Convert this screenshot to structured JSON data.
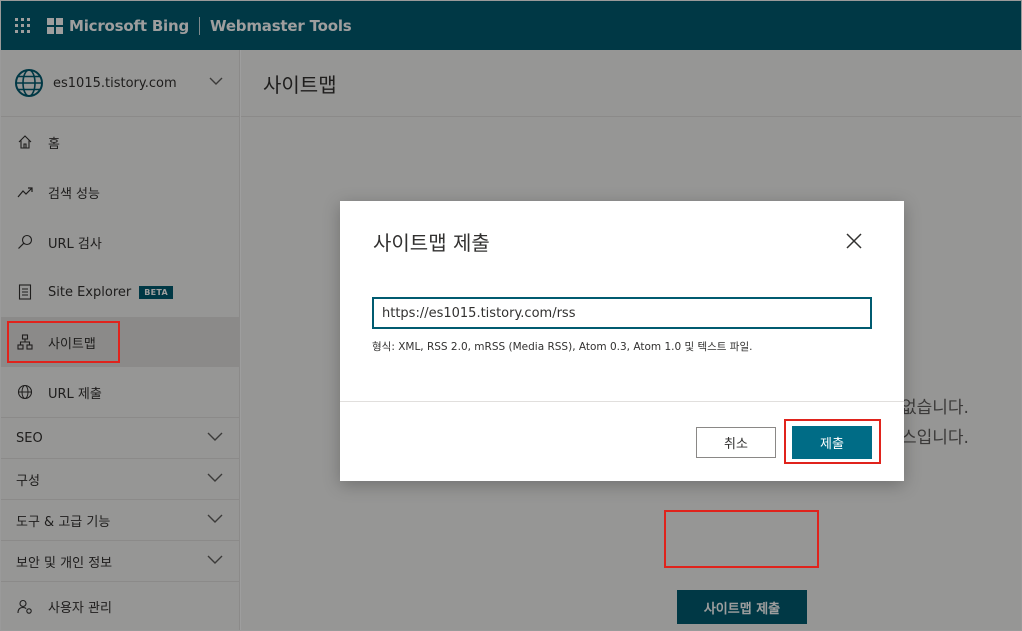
{
  "header": {
    "brand": "Microsoft Bing",
    "product": "Webmaster Tools"
  },
  "sidebar": {
    "site": "es1015.tistory.com",
    "items": [
      {
        "label": "홈",
        "icon": "home-icon"
      },
      {
        "label": "검색 성능",
        "icon": "trend-icon"
      },
      {
        "label": "URL 검사",
        "icon": "search-icon"
      },
      {
        "label": "Site Explorer",
        "icon": "document-list-icon",
        "badge": "BETA"
      },
      {
        "label": "사이트맵",
        "icon": "sitemap-icon",
        "active": true
      },
      {
        "label": "URL 제출",
        "icon": "globe-icon"
      }
    ],
    "groups": [
      {
        "label": "SEO"
      },
      {
        "label": "구성"
      },
      {
        "label": "도구 & 고급 기능"
      },
      {
        "label": "보안 및 개인 정보"
      }
    ],
    "bottom_item": {
      "label": "사용자 관리",
      "icon": "user-settings-icon"
    }
  },
  "main": {
    "page_title": "사이트맵",
    "bg_text_line1": "없습니다.",
    "bg_text_line2": "스입니다.",
    "submit_button": "사이트맵 제출"
  },
  "modal": {
    "title": "사이트맵 제출",
    "input_value": "https://es1015.tistory.com/rss",
    "hint": "형식: XML, RSS 2.0, mRSS (Media RSS), Atom 0.3, Atom 1.0 및 텍스트 파일.",
    "cancel_label": "취소",
    "submit_label": "제출"
  },
  "colors": {
    "brand": "#005b70",
    "highlight": "#e0231c"
  }
}
